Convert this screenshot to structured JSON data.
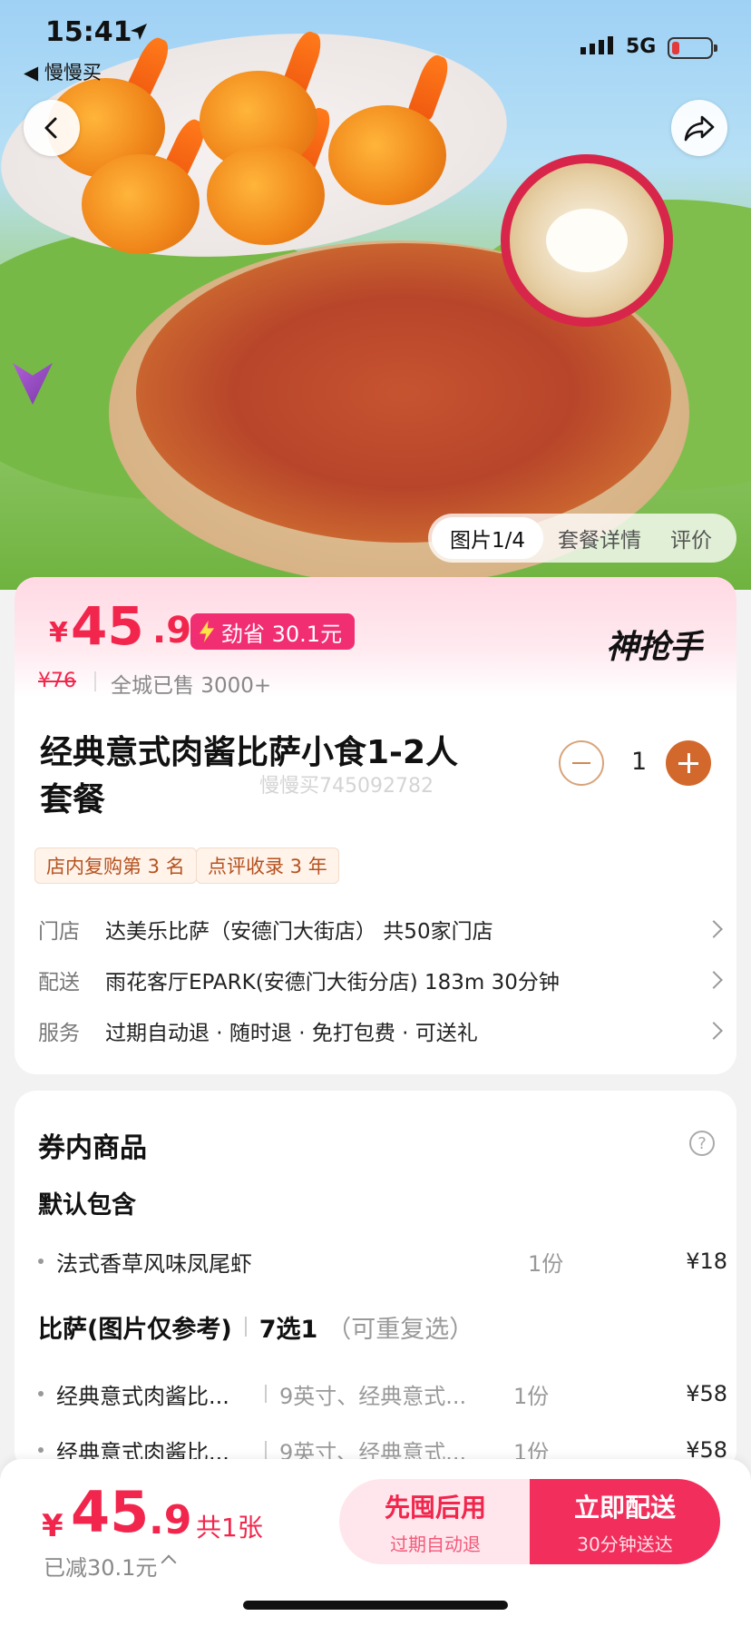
{
  "status_bar": {
    "time": "15:41",
    "back_app": "慢慢买",
    "network": "5G"
  },
  "image_tabs": {
    "active": "图片1/4",
    "detail": "套餐详情",
    "review": "评价"
  },
  "price": {
    "currency": "¥",
    "integer": "45",
    "decimal": ".9",
    "save_label": "劲省 30.1元",
    "original": "¥76",
    "sold": "全城已售 3000+",
    "brand_logo": "神抢手"
  },
  "product": {
    "title": "经典意式肉酱比萨小食1-2人套餐",
    "watermark": "慢慢买745092782",
    "quantity": "1",
    "tags": [
      "店内复购第 3 名",
      "点评收录 3 年"
    ],
    "info": [
      {
        "key": "门店",
        "value": "达美乐比萨（安德门大街店）   共50家门店"
      },
      {
        "key": "配送",
        "value": "雨花客厅EPARK(安德门大街分店)  183m   30分钟"
      },
      {
        "key": "服务",
        "value": "过期自动退 · 随时退 · 免打包费 · 可送礼"
      }
    ]
  },
  "coupon": {
    "title": "券内商品",
    "help": "?",
    "default_group": "默认包含",
    "default_items": [
      {
        "name": "法式香草风味凤尾虾",
        "qty": "1份",
        "price": "¥18"
      }
    ],
    "pizza_group": {
      "name": "比萨(图片仅参考)",
      "choose": "7选1",
      "note": "（可重复选）"
    },
    "pizza_items": [
      {
        "name": "经典意式肉酱比...",
        "desc": "9英寸、经典意式...",
        "qty": "1份",
        "price": "¥58"
      },
      {
        "name": "经典意式肉酱比...",
        "desc": "9英寸、经典意式...",
        "qty": "1份",
        "price": "¥58"
      }
    ]
  },
  "bottom_bar": {
    "currency": "¥",
    "integer": "45",
    "decimal": ".9",
    "count": "共1张",
    "saved": "已减30.1元",
    "btn_left": {
      "main": "先囤后用",
      "sub": "过期自动退"
    },
    "btn_right": {
      "main": "立即配送",
      "sub": "30分钟送达"
    }
  },
  "colors": {
    "accent": "#f2264c",
    "pink": "#f22e72",
    "orange": "#d2682c"
  }
}
